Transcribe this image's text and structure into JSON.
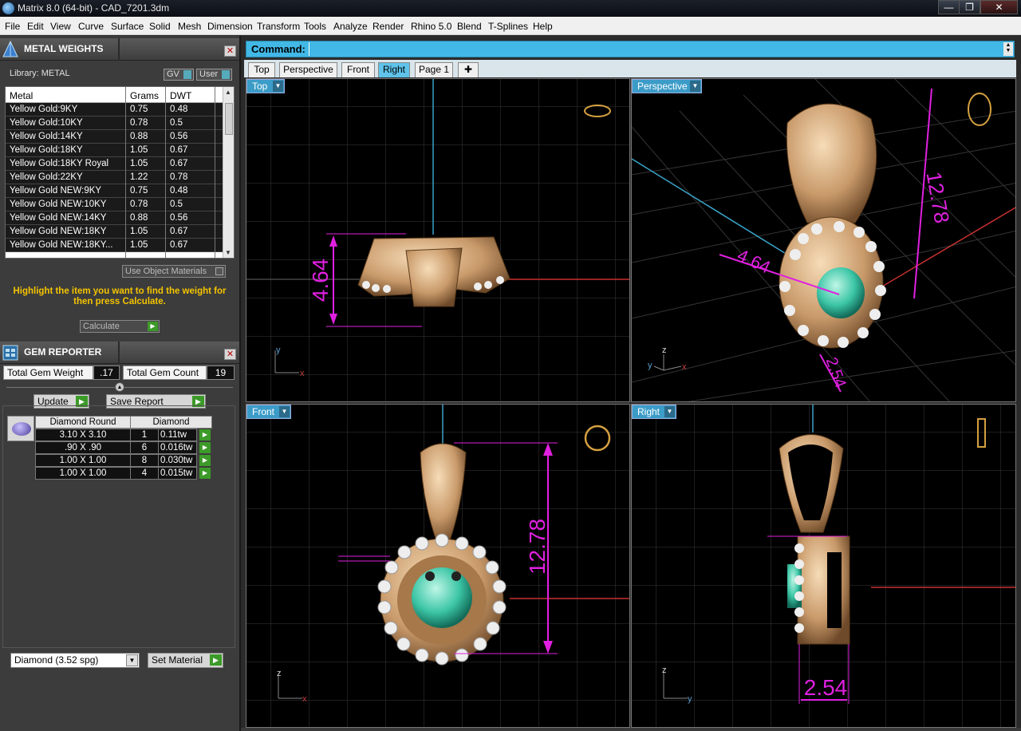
{
  "window": {
    "title": "Matrix 8.0 (64-bit) - CAD_7201.3dm",
    "min_label": "—",
    "max_label": "❐",
    "close_label": "✕"
  },
  "menu": [
    "File",
    "Edit",
    "View",
    "Curve",
    "Surface",
    "Solid",
    "Mesh",
    "Dimension",
    "Transform",
    "Tools",
    "Analyze",
    "Render",
    "Rhino 5.0",
    "Blend",
    "T-Splines",
    "Help"
  ],
  "metal_weights": {
    "title": "METAL WEIGHTS",
    "library_label": "Library: METAL",
    "gv_label": "GV",
    "user_label": "User",
    "columns": [
      "Metal",
      "Grams",
      "DWT"
    ],
    "rows": [
      [
        "Yellow Gold:9KY",
        "0.75",
        "0.48"
      ],
      [
        "Yellow Gold:10KY",
        "0.78",
        "0.5"
      ],
      [
        "Yellow Gold:14KY",
        "0.88",
        "0.56"
      ],
      [
        "Yellow Gold:18KY",
        "1.05",
        "0.67"
      ],
      [
        "Yellow Gold:18KY Royal",
        "1.05",
        "0.67"
      ],
      [
        "Yellow Gold:22KY",
        "1.22",
        "0.78"
      ],
      [
        "Yellow Gold NEW:9KY",
        "0.75",
        "0.48"
      ],
      [
        "Yellow Gold NEW:10KY",
        "0.78",
        "0.5"
      ],
      [
        "Yellow Gold NEW:14KY",
        "0.88",
        "0.56"
      ],
      [
        "Yellow Gold NEW:18KY",
        "1.05",
        "0.67"
      ],
      [
        "Yellow Gold NEW:18KY...",
        "1.05",
        "0.67"
      ]
    ],
    "use_object_materials": "Use Object Materials",
    "hint": "Highlight the item you want to find the weight for then press Calculate.",
    "calculate_label": "Calculate"
  },
  "gem_reporter": {
    "title": "GEM REPORTER",
    "total_weight_label": "Total Gem Weight",
    "total_weight_value": ".17",
    "total_count_label": "Total Gem Count",
    "total_count_value": "19",
    "update_label": "Update",
    "save_report_label": "Save Report",
    "columns": [
      "Diamond Round",
      "Diamond"
    ],
    "rows": [
      [
        "3.10 X 3.10",
        "1",
        "0.11tw"
      ],
      [
        ".90 X .90",
        "6",
        "0.016tw"
      ],
      [
        "1.00 X 1.00",
        "8",
        "0.030tw"
      ],
      [
        "1.00 X 1.00",
        "4",
        "0.015tw"
      ]
    ],
    "material_select": "Diamond     (3.52 spg)",
    "set_material_label": "Set Material"
  },
  "command": {
    "label": "Command:"
  },
  "view_tabs": [
    "Top",
    "Perspective",
    "Front",
    "Right",
    "Page 1",
    "✚"
  ],
  "active_tab": "Right",
  "viewports": {
    "top": {
      "label": "Top",
      "dimension": "4.64",
      "axis_a": "y",
      "axis_b": "x"
    },
    "perspective": {
      "label": "Perspective",
      "dimensions": [
        "12.78",
        "4.64",
        "2.54"
      ],
      "axis_a": "z",
      "axis_b": "x",
      "axis_c": "y"
    },
    "front": {
      "label": "Front",
      "dimension": "12.78",
      "axis_a": "z",
      "axis_b": "x"
    },
    "right": {
      "label": "Right",
      "dimension": "2.54",
      "axis_a": "z",
      "axis_b": "y"
    }
  },
  "colors": {
    "accent": "#42b8e6",
    "dimension": "#e020e0",
    "metal": "#d9b48a",
    "gem": "#40c8a8",
    "grid": "#3a3a3a"
  }
}
